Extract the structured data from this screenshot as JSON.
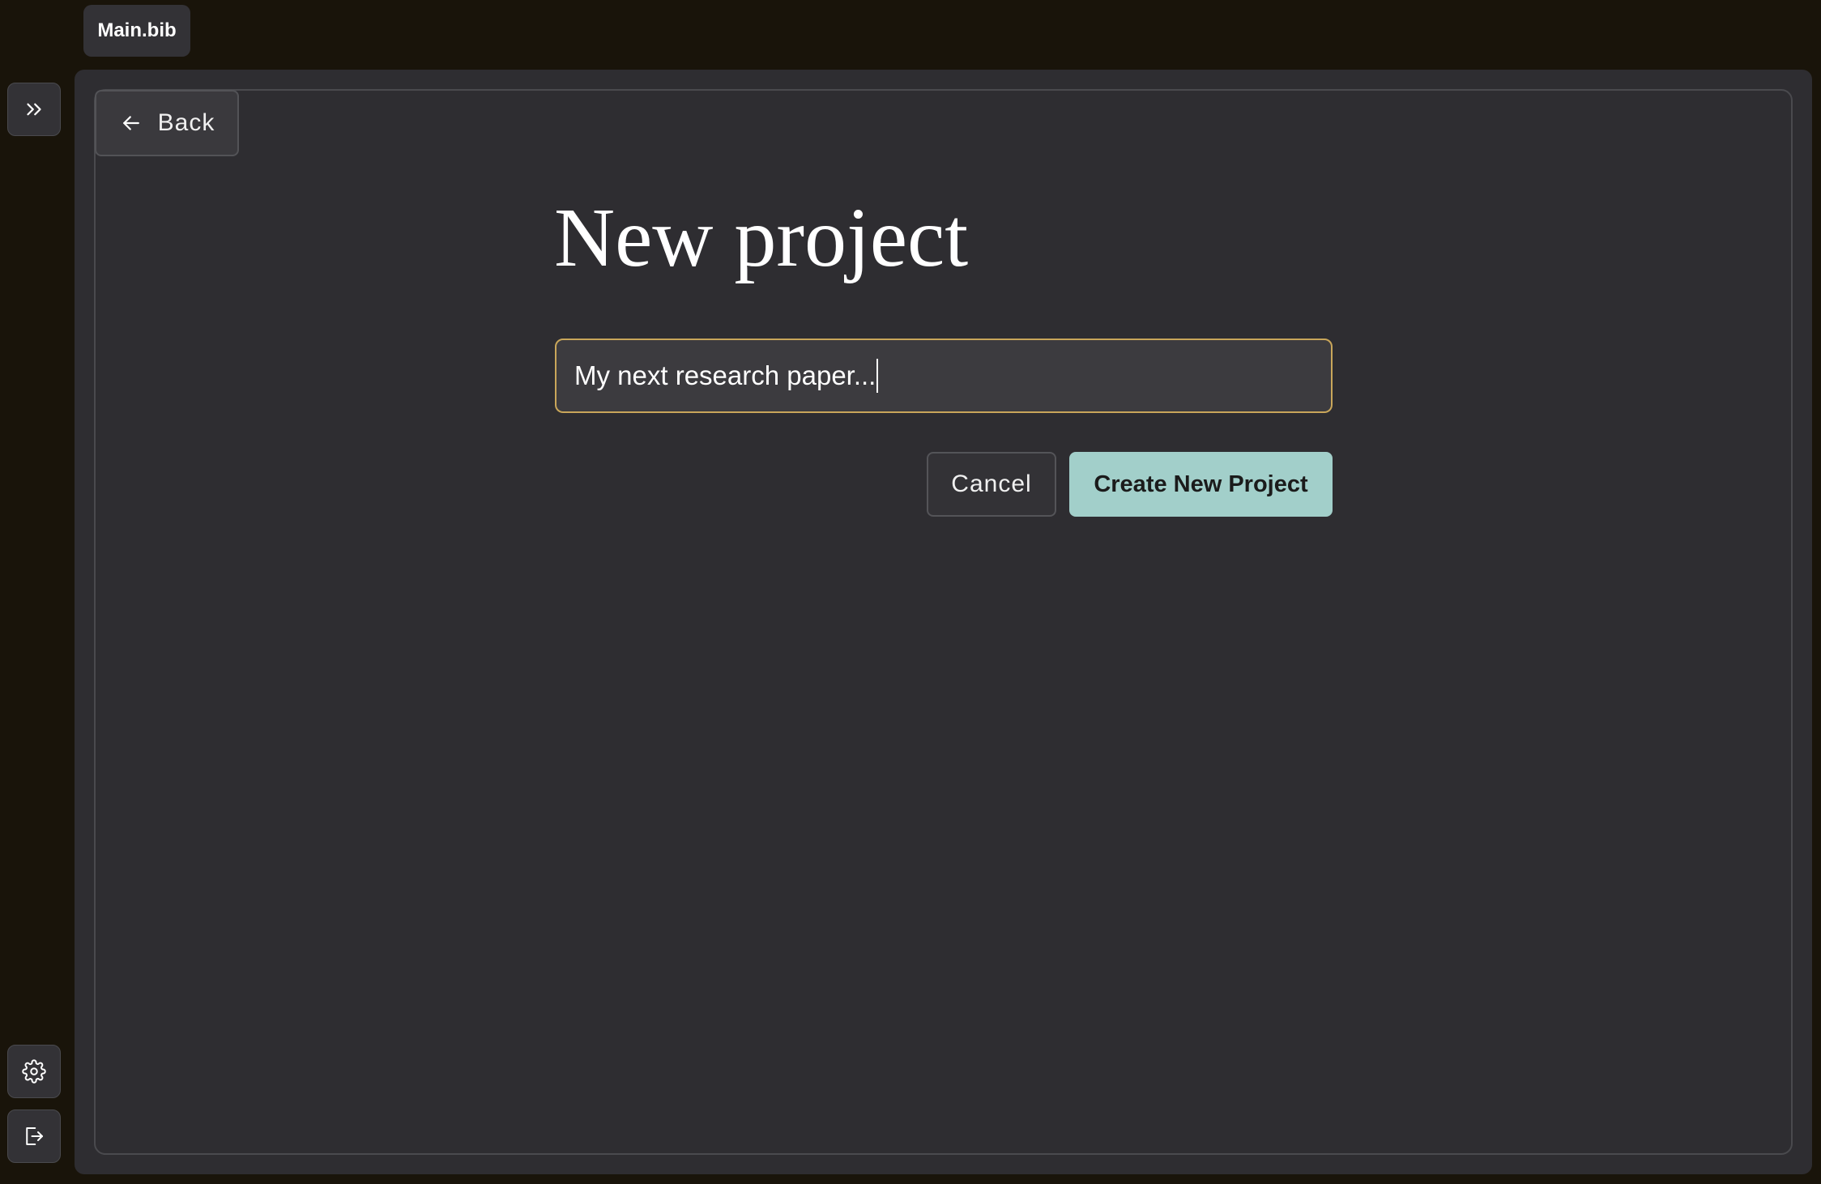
{
  "tabs": [
    {
      "label": "Main.bib"
    }
  ],
  "sidebar": {
    "expand_icon": "chevrons-right-icon",
    "settings_icon": "gear-icon",
    "logout_icon": "logout-icon"
  },
  "header": {
    "back_label": "Back",
    "back_icon": "arrow-left-icon"
  },
  "main": {
    "title": "New project",
    "project_name_input": {
      "value": "My next research paper..."
    },
    "cancel_label": "Cancel",
    "create_label": "Create New Project"
  },
  "colors": {
    "background": "#19140a",
    "panel": "#2e2d31",
    "input_focus_border": "#c9a65a",
    "primary_button": "#a2cfca"
  }
}
